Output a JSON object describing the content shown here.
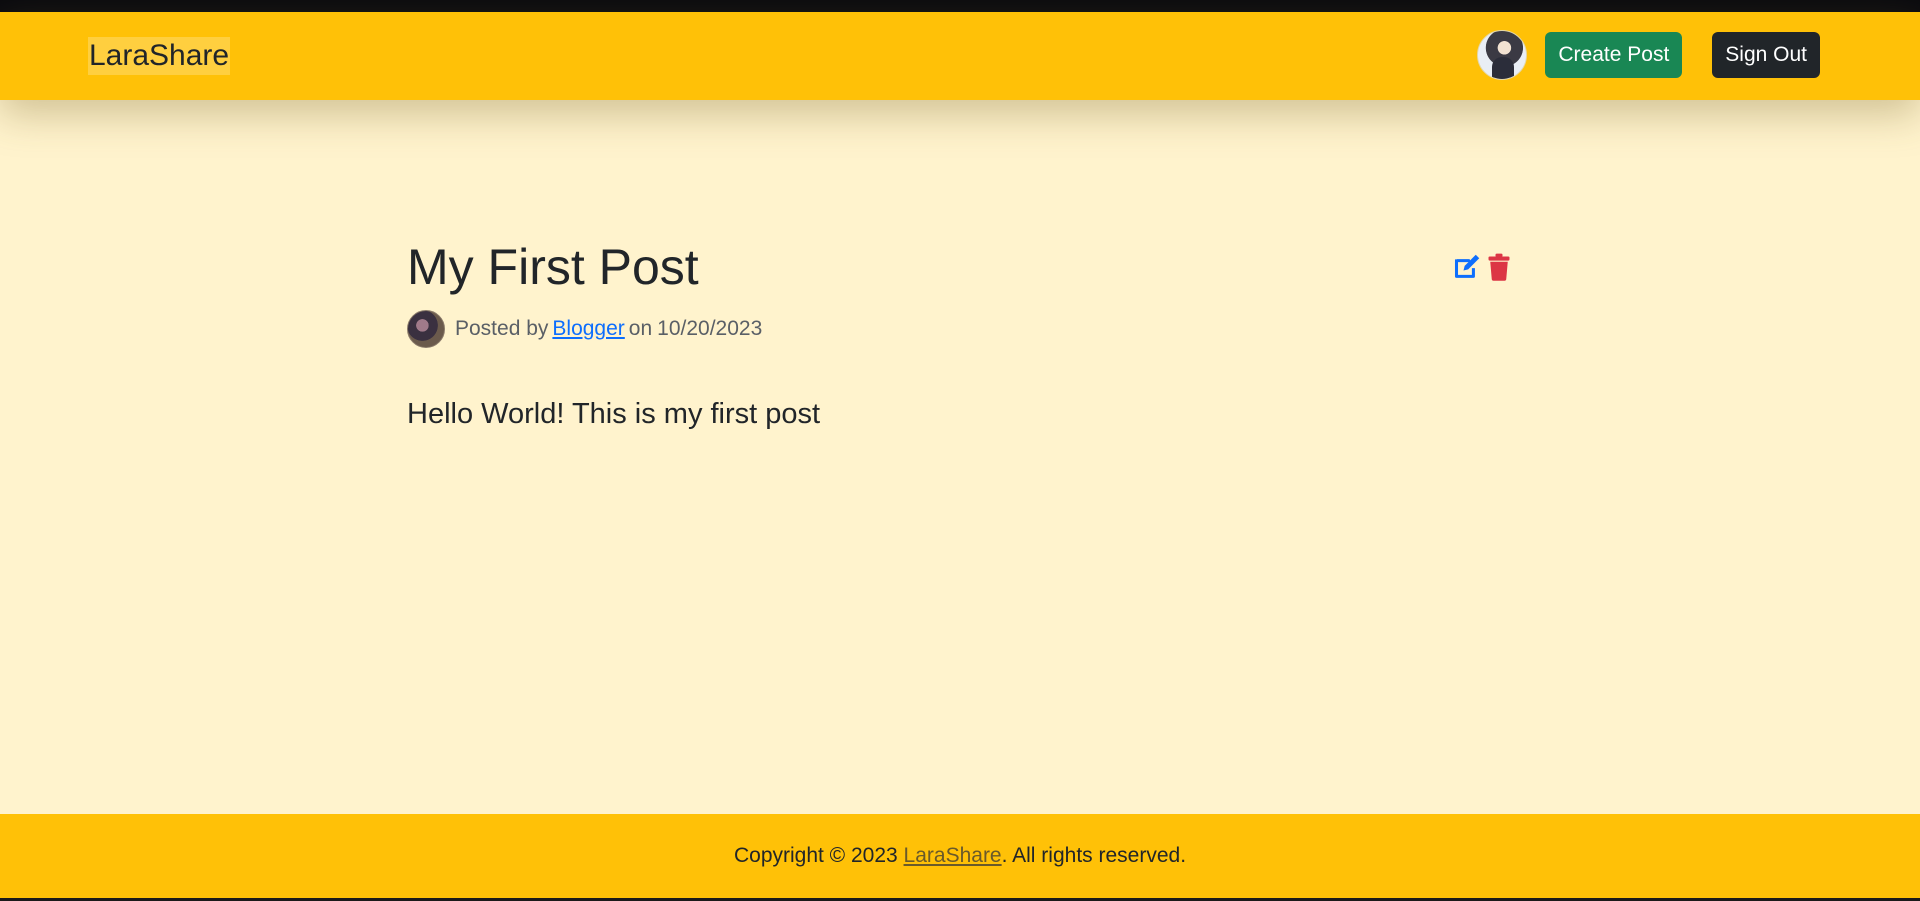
{
  "header": {
    "brand": "LaraShare",
    "create_post_label": "Create Post",
    "sign_out_label": "Sign Out"
  },
  "post": {
    "title": "My First Post",
    "posted_by_prefix": "Posted by",
    "author": "Blogger",
    "date_prefix": "on",
    "date": "10/20/2023",
    "body": "Hello World! This is my first post"
  },
  "footer": {
    "copyright_prefix": "Copyright © 2023",
    "brand_link": "LaraShare",
    "copyright_suffix": ". All rights reserved."
  },
  "colors": {
    "navbar": "#ffc107",
    "background": "#fff3cd",
    "create_button": "#198754",
    "sign_out_button": "#212529",
    "edit_icon": "#0d6efd",
    "delete_icon": "#dc3545"
  },
  "icons": {
    "edit": "edit-icon",
    "delete": "trash-icon"
  }
}
